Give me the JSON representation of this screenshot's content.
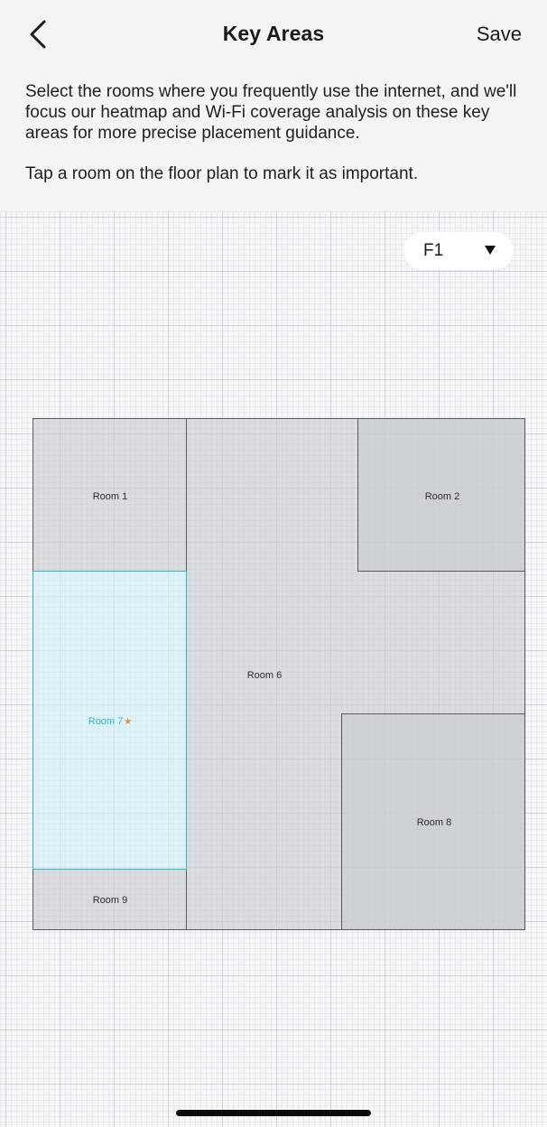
{
  "header": {
    "title": "Key Areas",
    "save_label": "Save",
    "back_icon": "chevron-left-icon"
  },
  "instructions": {
    "body": "Select the rooms where you frequently use the internet, and we'll focus our heatmap and Wi-Fi coverage analysis on these key areas for more precise placement guidance.",
    "hint": "Tap a room on the floor plan to mark it as important."
  },
  "floor_selector": {
    "value": "F1",
    "icon": "caret-down-icon"
  },
  "rooms": {
    "room1": {
      "label": "Room 1",
      "selected": false
    },
    "room2": {
      "label": "Room 2",
      "selected": false
    },
    "room6": {
      "label": "Room 6",
      "selected": false
    },
    "room7": {
      "label": "Room 7",
      "selected": true,
      "marker": "★"
    },
    "room8": {
      "label": "Room 8",
      "selected": false
    },
    "room9": {
      "label": "Room 9",
      "selected": false
    }
  },
  "colors": {
    "selected_room": "#2bb6cc",
    "marker": "#f08a24",
    "room_fill": "#c8cbcf"
  }
}
